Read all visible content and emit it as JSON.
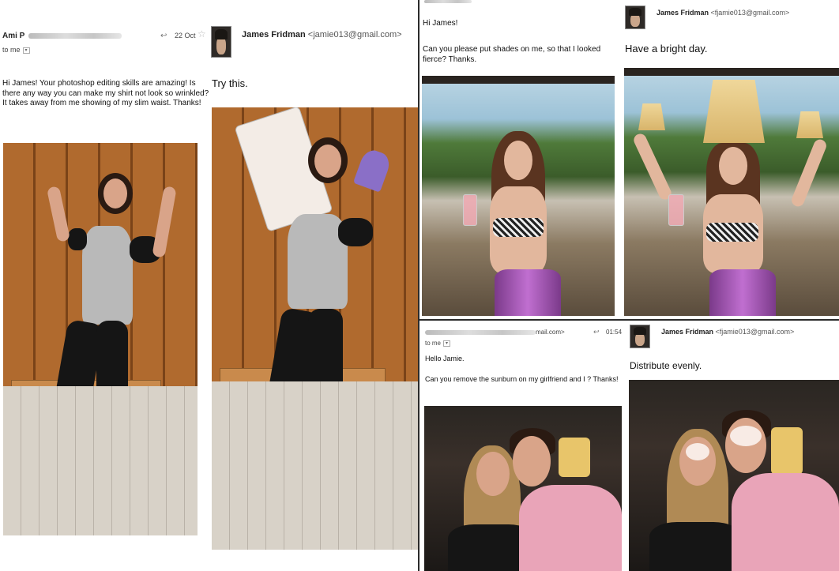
{
  "panel_tl": {
    "sender_name": "Ami P",
    "to_line": "to me",
    "date": "22 Oct",
    "body": "Hi James! Your photoshop editing skills are amazing! Is there any way you can make my shirt not look so wrinkled? It takes away from me showing of my slim waist. Thanks!",
    "reply_sender": "James Fridman",
    "reply_email": "<jamie013@gmail.com>",
    "reply_text": "Try this."
  },
  "panel_tr": {
    "greeting": "Hi James!",
    "body": "Can you please put shades on me, so that I looked fierce? Thanks.",
    "reply_sender": "James Fridman",
    "reply_email": "<fjamie013@gmail.com>",
    "reply_text": "Have a bright day."
  },
  "panel_br": {
    "sender_email_fragment": "mail.com>",
    "time": "01:54",
    "to_line": "to me",
    "greeting": "Hello Jamie.",
    "body": "Can you remove the sunburn on my girlfriend and I ? Thanks!",
    "reply_sender": "James Fridman",
    "reply_email": "<fjamie013@gmail.com>",
    "reply_text": "Distribute evenly."
  },
  "icons": {
    "reply": "↩",
    "star": "☆",
    "dropdown": "▾"
  },
  "colors": {
    "divider": "#2b2b2b",
    "locker": "#a86428",
    "bikini_skirt": "#c06fd0",
    "shirt_pink": "#e9a4b8"
  }
}
